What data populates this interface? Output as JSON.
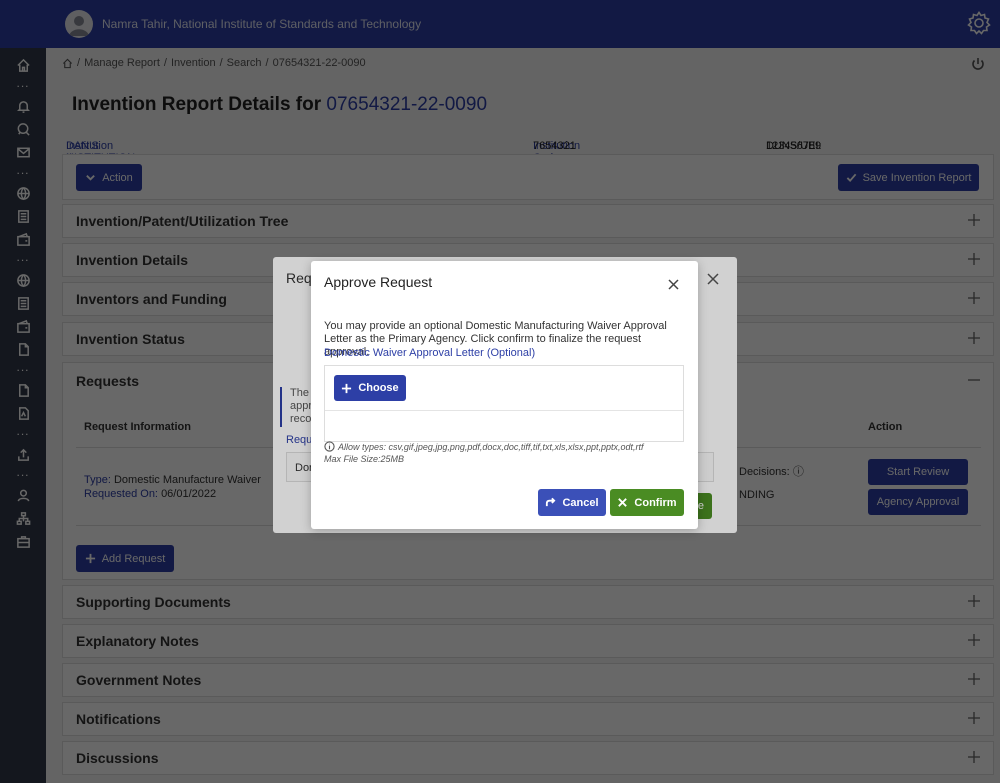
{
  "header": {
    "user_name": "Namra Tahir, National Institute of Standards and Technology"
  },
  "sidebar": {
    "icons": [
      "home-icon",
      "bell-icon",
      "search-chat-icon",
      "mail-icon",
      "globe-icon",
      "document-icon",
      "wallet-icon",
      "globe-icon",
      "document-icon",
      "wallet-icon",
      "file-icon",
      "file-icon",
      "pdf-icon",
      "upload-icon",
      "user-icon",
      "hierarchy-icon",
      "briefcase-icon"
    ]
  },
  "breadcrumb": [
    "Manage Report",
    "Invention",
    "Search",
    "07654321-22-0090"
  ],
  "page": {
    "title_prefix": "Invention Report Details for",
    "report_number": "07654321-22-0090"
  },
  "institution": {
    "name_label": "Institution Name:",
    "name_value": "DAN'S INSTITUTION",
    "code_label": "Institution Code:",
    "code_value": "7654321",
    "duns_label": "DUNS/UEI:",
    "duns_value": "123456789"
  },
  "actions": {
    "action_label": "Action",
    "save_label": "Save Invention Report"
  },
  "sections": {
    "tree": "Invention/Patent/Utilization Tree",
    "details": "Invention Details",
    "inventors": "Inventors and Funding",
    "status": "Invention Status",
    "requests": "Requests",
    "supporting": "Supporting Documents",
    "explanatory": "Explanatory Notes",
    "government": "Government Notes",
    "notifications": "Notifications",
    "discussions": "Discussions"
  },
  "requests_table": {
    "col_info": "Request Information",
    "col_action": "Action",
    "type_label": "Type:",
    "type_value": "Domestic Manufacture Waiver",
    "requested_on_label": "Requested On:",
    "requested_on_value": "06/01/2022",
    "decisions_label": "Decisions:",
    "status_fragment": "NDING",
    "start_review_label": "Start Review",
    "agency_approval_label": "Agency Approval",
    "add_request_label": "Add Request"
  },
  "background_modal": {
    "title_fragment": "Requ",
    "note_fragment": "The C appro recon",
    "req_fragment": "Requ",
    "dom_fragment": "Dor",
    "green_fragment": "e"
  },
  "modal": {
    "title": "Approve Request",
    "body": "You may provide an optional Domestic Manufacturing Waiver Approval Letter as the Primary Agency. Click confirm to finalize the request approval.",
    "waiver_label": "Domestic Waiver Approval Letter (Optional)",
    "choose_label": "Choose",
    "allow_types": "Allow types: csv,gif,jpeg,jpg,png,pdf,docx,doc,tiff,tif,txt,xls,xlsx,ppt,pptx,odt,rtf",
    "max_size": "Max File Size:25MB",
    "cancel_label": "Cancel",
    "confirm_label": "Confirm"
  },
  "colors": {
    "primary": "#2d3fa6",
    "sidebar": "#333a4a",
    "confirm": "#4a8c23"
  }
}
